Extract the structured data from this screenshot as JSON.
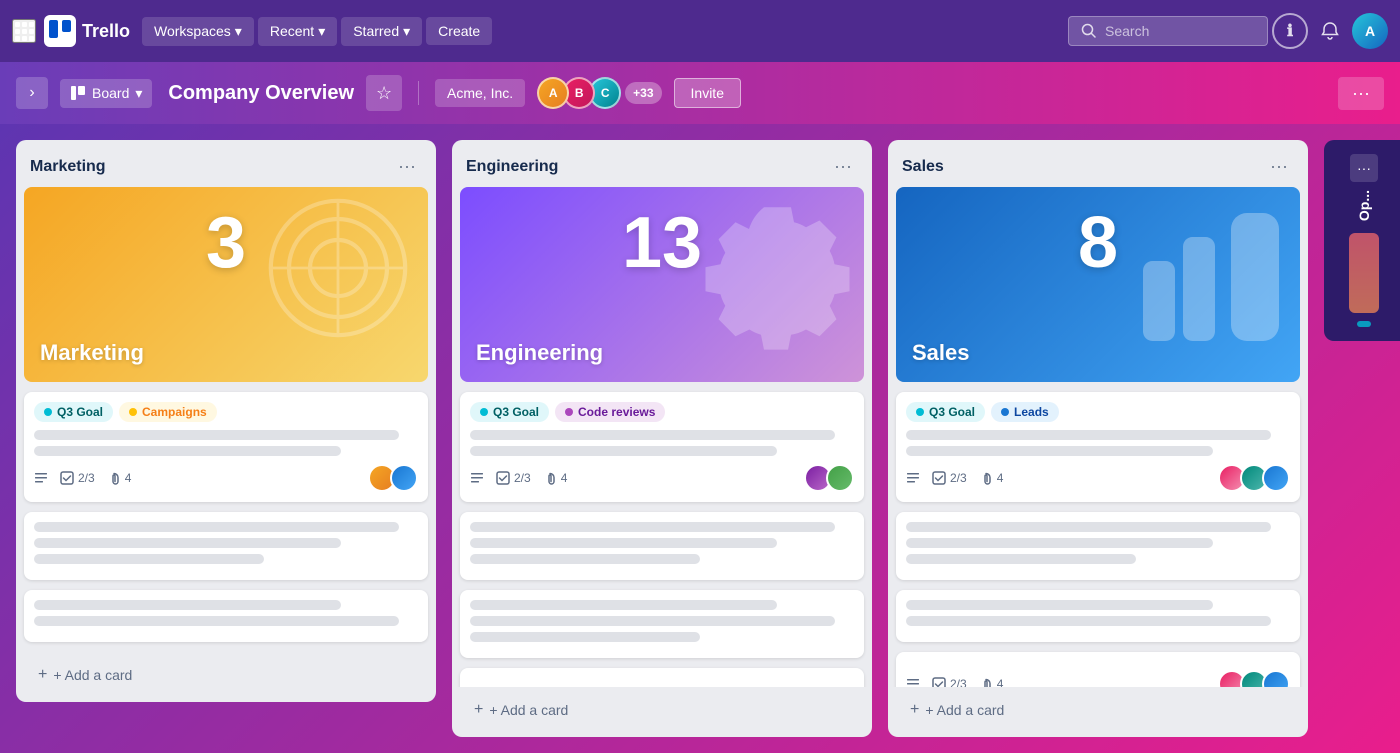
{
  "app": {
    "name": "Trello",
    "logo_text": "Trello"
  },
  "topnav": {
    "workspaces_label": "Workspaces",
    "recent_label": "Recent",
    "starred_label": "Starred",
    "create_label": "Create",
    "search_placeholder": "Search"
  },
  "board_header": {
    "view_label": "Board",
    "title": "Company Overview",
    "workspace_label": "Acme, Inc.",
    "member_count": "+33",
    "invite_label": "Invite"
  },
  "columns": [
    {
      "id": "marketing",
      "title": "Marketing",
      "hero": {
        "number": "3",
        "label": "Marketing",
        "style": "marketing"
      },
      "main_card": {
        "tags": [
          {
            "label": "Q3 Goal",
            "style": "cyan"
          },
          {
            "label": "Campaigns",
            "style": "yellow"
          }
        ],
        "checklist": "2/3",
        "attachments": "4",
        "avatars": [
          "orange",
          "blue"
        ]
      },
      "add_card_label": "+ Add a card"
    },
    {
      "id": "engineering",
      "title": "Engineering",
      "hero": {
        "number": "13",
        "label": "Engineering",
        "style": "engineering"
      },
      "main_card": {
        "tags": [
          {
            "label": "Q3 Goal",
            "style": "cyan"
          },
          {
            "label": "Code reviews",
            "style": "purple"
          }
        ],
        "checklist": "2/3",
        "attachments": "4",
        "avatars": [
          "purple",
          "green"
        ]
      },
      "add_card_label": "+ Add a card"
    },
    {
      "id": "sales",
      "title": "Sales",
      "hero": {
        "number": "8",
        "label": "Sales",
        "style": "sales"
      },
      "main_card": {
        "tags": [
          {
            "label": "Q3 Goal",
            "style": "cyan"
          },
          {
            "label": "Leads",
            "style": "blue"
          }
        ],
        "checklist": "2/3",
        "attachments": "4",
        "avatars": [
          "pink",
          "teal",
          "blue"
        ]
      },
      "add_card_label": "+ Add a card"
    }
  ],
  "partial_column": {
    "title": "Op..."
  },
  "icons": {
    "grid": "⊞",
    "chevron_down": "▾",
    "search": "🔍",
    "star": "☆",
    "bell": "🔔",
    "info": "ⓘ",
    "menu": "···",
    "plus": "+",
    "list": "≡",
    "check": "☑",
    "clip": "📎",
    "board_icon": "▦"
  }
}
